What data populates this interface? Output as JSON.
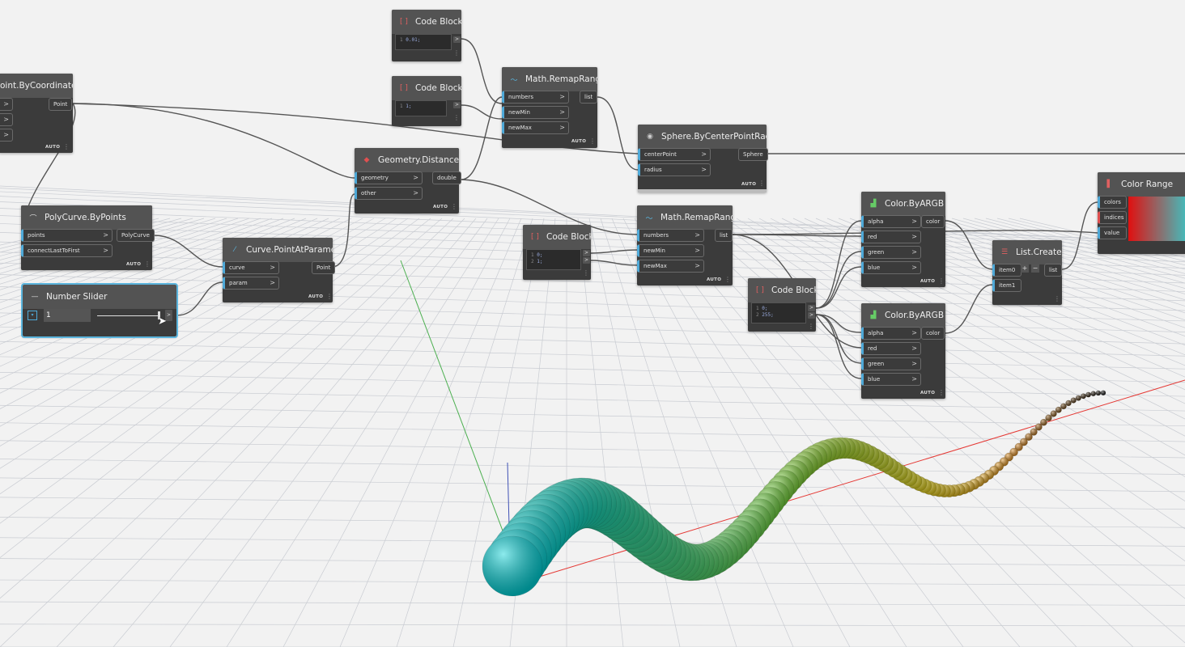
{
  "nodes": {
    "code1": {
      "title": "Code Block",
      "lines": [
        "1",
        "0.01;"
      ]
    },
    "code2": {
      "title": "Code Block",
      "lines": [
        "1",
        "1;"
      ]
    },
    "code3": {
      "title": "Code Block",
      "lines": [
        "1",
        "0;",
        "2",
        "1;"
      ]
    },
    "code4": {
      "title": "Code Block",
      "lines": [
        "1",
        "0;",
        "2",
        "255;"
      ]
    },
    "pointByCoords": {
      "title": "oint.ByCoordinates",
      "output": "Point",
      "auto": "AUTO"
    },
    "polyCurve": {
      "title": "PolyCurve.ByPoints",
      "inputs": [
        "points",
        "connectLastToFirst"
      ],
      "output": "PolyCurve",
      "auto": "AUTO"
    },
    "numberSlider": {
      "title": "Number Slider",
      "value": "1"
    },
    "curvePoint": {
      "title": "Curve.PointAtParameter",
      "inputs": [
        "curve",
        "param"
      ],
      "output": "Point",
      "auto": "AUTO"
    },
    "distanceTo": {
      "title": "Geometry.DistanceTo",
      "inputs": [
        "geometry",
        "other"
      ],
      "output": "double",
      "auto": "AUTO"
    },
    "remap1": {
      "title": "Math.RemapRange",
      "inputs": [
        "numbers",
        "newMin",
        "newMax"
      ],
      "output": "list",
      "auto": "AUTO"
    },
    "remap2": {
      "title": "Math.RemapRange",
      "inputs": [
        "numbers",
        "newMin",
        "newMax"
      ],
      "output": "list",
      "auto": "AUTO"
    },
    "sphere": {
      "title": "Sphere.ByCenterPointRadius",
      "inputs": [
        "centerPoint",
        "radius"
      ],
      "output": "Sphere",
      "auto": "AUTO"
    },
    "colorA": {
      "title": "Color.ByARGB",
      "inputs": [
        "alpha",
        "red",
        "green",
        "blue"
      ],
      "output": "color",
      "auto": "AUTO"
    },
    "colorB": {
      "title": "Color.ByARGB",
      "inputs": [
        "alpha",
        "red",
        "green",
        "blue"
      ],
      "output": "color",
      "auto": "AUTO"
    },
    "listCreate": {
      "title": "List.Create",
      "inputs": [
        "item0",
        "item1"
      ],
      "output": "list",
      "add": "+",
      "remove": "−"
    },
    "colorRange": {
      "title": "Color Range",
      "inputs": [
        "colors",
        "indices",
        "value"
      ]
    }
  },
  "colors": {
    "accent": "#4ea9d8",
    "node": "#3b3b3b",
    "header": "#535353",
    "canvas": "#f2f2f2"
  }
}
